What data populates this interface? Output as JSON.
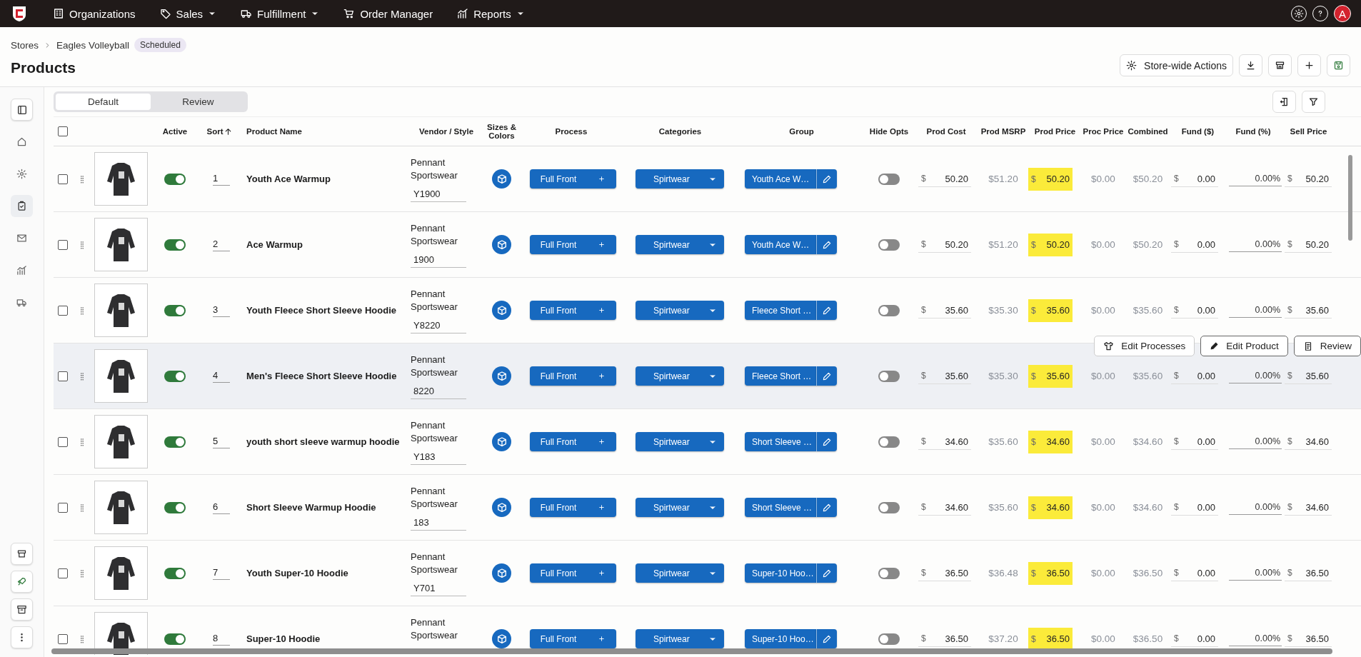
{
  "nav": {
    "items": [
      {
        "label": "Organizations",
        "has_menu": false
      },
      {
        "label": "Sales",
        "has_menu": true
      },
      {
        "label": "Fulfillment",
        "has_menu": true
      },
      {
        "label": "Order Manager",
        "has_menu": false
      },
      {
        "label": "Reports",
        "has_menu": true
      }
    ],
    "avatar": "A"
  },
  "breadcrumb": [
    "Stores",
    "Eagles Volleyball"
  ],
  "status_badge": "Scheduled",
  "title": "Products",
  "store_actions": "Store-wide Actions",
  "sidebar": {
    "items": [
      {
        "selected": false
      },
      {
        "selected": false
      },
      {
        "selected": true
      },
      {
        "selected": false
      },
      {
        "selected": false
      },
      {
        "selected": false
      }
    ]
  },
  "tabs": [
    {
      "label": "Default",
      "selected": true
    },
    {
      "label": "Review",
      "selected": false
    }
  ],
  "table": {
    "select_all_checked": false,
    "columns": [
      "Active",
      "Sort",
      "Product Name",
      "Vendor / Style",
      "Sizes & Colors",
      "Process",
      "Categories",
      "Group",
      "Hide Opts",
      "Prod Cost",
      "Prod MSRP",
      "Prod Price",
      "Proc Price",
      "Combined",
      "Fund ($)",
      "Fund (%)",
      "Sell Price"
    ],
    "row_actions": [
      "Edit Processes",
      "Edit Product",
      "Review"
    ],
    "rows": [
      {
        "checked": false,
        "highlighted": false,
        "active": true,
        "sort": "1",
        "name": "Youth Ace Warmup",
        "vendor": "Pennant Sportswear",
        "style": "Y1900",
        "process": "Full Front",
        "category": "Spirtwear",
        "group": "Youth Ace W…",
        "hide_opts": false,
        "cost": {
          "unit": "$",
          "value": "50.20"
        },
        "msrp": "$51.20",
        "price": {
          "unit": "$",
          "value": "50.20"
        },
        "proc_price": "$0.00",
        "combined": "$50.20",
        "fund": {
          "unit": "$",
          "value": "0.00"
        },
        "fund_pct": "0.00%",
        "sell": {
          "unit": "$",
          "value": "50.20"
        }
      },
      {
        "checked": false,
        "highlighted": false,
        "active": true,
        "sort": "2",
        "name": "Ace Warmup",
        "vendor": "Pennant Sportswear",
        "style": "1900",
        "process": "Full Front",
        "category": "Spirtwear",
        "group": "Youth Ace W…",
        "hide_opts": false,
        "cost": {
          "unit": "$",
          "value": "50.20"
        },
        "msrp": "$51.20",
        "price": {
          "unit": "$",
          "value": "50.20"
        },
        "proc_price": "$0.00",
        "combined": "$50.20",
        "fund": {
          "unit": "$",
          "value": "0.00"
        },
        "fund_pct": "0.00%",
        "sell": {
          "unit": "$",
          "value": "50.20"
        }
      },
      {
        "checked": false,
        "highlighted": false,
        "active": true,
        "sort": "3",
        "name": "Youth Fleece Short Sleeve Hoodie",
        "vendor": "Pennant Sportswear",
        "style": "Y8220",
        "process": "Full Front",
        "category": "Spirtwear",
        "group": "Fleece Short …",
        "hide_opts": false,
        "cost": {
          "unit": "$",
          "value": "35.60"
        },
        "msrp": "$35.30",
        "price": {
          "unit": "$",
          "value": "35.60"
        },
        "proc_price": "$0.00",
        "combined": "$35.60",
        "fund": {
          "unit": "$",
          "value": "0.00"
        },
        "fund_pct": "0.00%",
        "sell": {
          "unit": "$",
          "value": "35.60"
        }
      },
      {
        "checked": false,
        "highlighted": true,
        "active": true,
        "sort": "4",
        "name": "Men's Fleece Short Sleeve Hoodie",
        "vendor": "Pennant Sportswear",
        "style": "8220",
        "process": "Full Front",
        "category": "Spirtwear",
        "group": "Fleece Short …",
        "hide_opts": false,
        "cost": {
          "unit": "$",
          "value": "35.60"
        },
        "msrp": "$35.30",
        "price": {
          "unit": "$",
          "value": "35.60"
        },
        "proc_price": "$0.00",
        "combined": "$35.60",
        "fund": {
          "unit": "$",
          "value": "0.00"
        },
        "fund_pct": "0.00%",
        "sell": {
          "unit": "$",
          "value": "35.60"
        }
      },
      {
        "checked": false,
        "highlighted": false,
        "active": true,
        "sort": "5",
        "name": "youth short sleeve warmup hoodie",
        "vendor": "Pennant Sportswear",
        "style": "Y183",
        "process": "Full Front",
        "category": "Spirtwear",
        "group": "Short Sleeve …",
        "hide_opts": false,
        "cost": {
          "unit": "$",
          "value": "34.60"
        },
        "msrp": "$35.60",
        "price": {
          "unit": "$",
          "value": "34.60"
        },
        "proc_price": "$0.00",
        "combined": "$34.60",
        "fund": {
          "unit": "$",
          "value": "0.00"
        },
        "fund_pct": "0.00%",
        "sell": {
          "unit": "$",
          "value": "34.60"
        }
      },
      {
        "checked": false,
        "highlighted": false,
        "active": true,
        "sort": "6",
        "name": "Short Sleeve Warmup Hoodie",
        "vendor": "Pennant Sportswear",
        "style": "183",
        "process": "Full Front",
        "category": "Spirtwear",
        "group": "Short Sleeve …",
        "hide_opts": false,
        "cost": {
          "unit": "$",
          "value": "34.60"
        },
        "msrp": "$35.60",
        "price": {
          "unit": "$",
          "value": "34.60"
        },
        "proc_price": "$0.00",
        "combined": "$34.60",
        "fund": {
          "unit": "$",
          "value": "0.00"
        },
        "fund_pct": "0.00%",
        "sell": {
          "unit": "$",
          "value": "34.60"
        }
      },
      {
        "checked": false,
        "highlighted": false,
        "active": true,
        "sort": "7",
        "name": "Youth Super-10 Hoodie",
        "vendor": "Pennant Sportswear",
        "style": "Y701",
        "process": "Full Front",
        "category": "Spirtwear",
        "group": "Super-10 Hoo…",
        "hide_opts": false,
        "cost": {
          "unit": "$",
          "value": "36.50"
        },
        "msrp": "$36.48",
        "price": {
          "unit": "$",
          "value": "36.50"
        },
        "proc_price": "$0.00",
        "combined": "$36.50",
        "fund": {
          "unit": "$",
          "value": "0.00"
        },
        "fund_pct": "0.00%",
        "sell": {
          "unit": "$",
          "value": "36.50"
        }
      },
      {
        "checked": false,
        "highlighted": false,
        "active": true,
        "sort": "8",
        "name": "Super-10 Hoodie",
        "vendor": "Pennant Sportswear",
        "process": "Full Front",
        "category": "Spirtwear",
        "group": "Super-10 Hoo…",
        "hide_opts": false,
        "cost": {
          "unit": "$",
          "value": "36.50"
        },
        "msrp": "$37.20",
        "price": {
          "unit": "$",
          "value": "36.50"
        },
        "proc_price": "$0.00",
        "combined": "$36.50",
        "fund": {
          "unit": "$",
          "value": "0.00"
        },
        "fund_pct": "0.00%",
        "sell": {
          "unit": "$",
          "value": "36.50"
        }
      }
    ]
  }
}
